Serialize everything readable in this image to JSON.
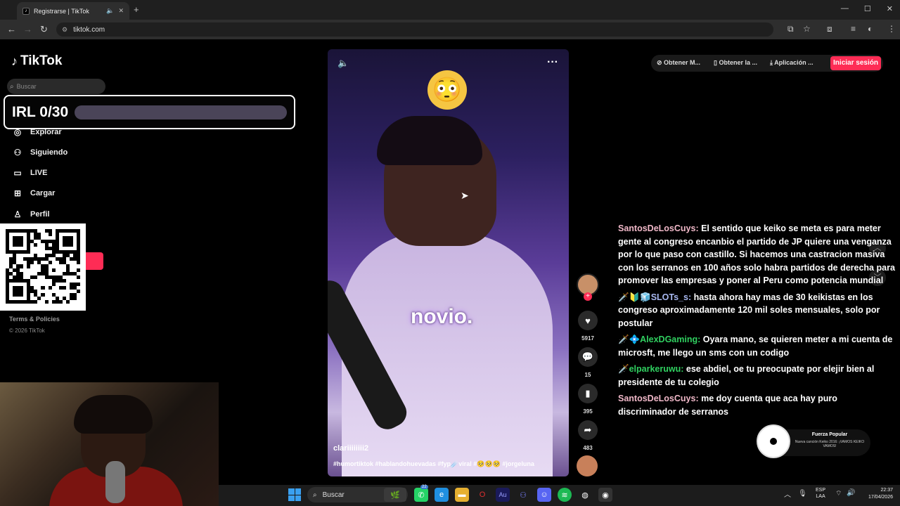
{
  "browser": {
    "tab_title": "Registrarse | TikTok",
    "tab_favicon": "tiktok-favicon",
    "url": "tiktok.com",
    "new_tab": "+",
    "win_controls": [
      "—",
      "☐",
      "✕"
    ]
  },
  "tiktok": {
    "logo": "TikTok",
    "search_placeholder": "Buscar",
    "nav": [
      {
        "label": "Explorar",
        "icon": "compass-icon"
      },
      {
        "label": "Siguiendo",
        "icon": "users-icon"
      },
      {
        "label": "LIVE",
        "icon": "live-icon"
      },
      {
        "label": "Cargar",
        "icon": "upload-icon"
      },
      {
        "label": "Perfil",
        "icon": "person-icon"
      }
    ],
    "terms": "Terms & Policies",
    "copyright": "© 2026 TikTok",
    "topbar": {
      "item1": "Obtener M...",
      "item2": "Obtener la ...",
      "item3": "Aplicación ...",
      "login": "Iniciar sesión"
    }
  },
  "irl_goal": {
    "label": "IRL 0/30",
    "progress": 0
  },
  "video": {
    "caption": "novio.",
    "username": "clariiiiiiii2",
    "hashtags": "#humortiktok #hablandohuevadas #fyp☄️viral #🥺🥺🥺 #jorgeluna",
    "emoji": "😳",
    "likes": "5917",
    "comments": "15",
    "saves": "395",
    "shares": "483"
  },
  "chat": [
    {
      "user": "SantosDeLosCuys:",
      "color": "#f0b8c8",
      "badges": "",
      "text": " El sentido que keiko se meta es para meter gente al congreso encanbio el partido de JP quiere una venganza por lo que paso con castillo. Si hacemos una castracion masiva con los serranos en 100 años solo habra partidos de derecha para promover las empresas y poner al Peru como potencia mundial"
    },
    {
      "user": "SLOTs_s:",
      "color": "#a8b8f0",
      "badges": "🗡️🔰🧊",
      "text": " hasta ahora hay mas de 30 keikistas en los congreso aproximadamente 120 mil soles mensuales, solo por postular"
    },
    {
      "user": "AlexDGaming:",
      "color": "#30d060",
      "badges": "🗡️💠",
      "text": " Oyara mano, se quieren meter a mi cuenta de microsft, me llego un sms con un codigo"
    },
    {
      "user": "elparkeruwu:",
      "color": "#30d060",
      "badges": "🗡️",
      "text": " ese abdiel, oe tu preocupate por elejir bien al presidente de tu colegio"
    },
    {
      "user": "SantosDeLosCuys:",
      "color": "#f0b8c8",
      "badges": "",
      "text": " me doy cuenta que aca hay puro discriminador de serranos"
    }
  ],
  "music_widget": {
    "title": "Fuerza Popular",
    "subtitle": "Nueva canción Keiko 2016: ¡VAMOS KEIKO VAMOS!"
  },
  "taskbar": {
    "search": "Buscar",
    "lang_top": "ESP",
    "lang_bottom": "LAA",
    "time": "22:37",
    "date": "17/04/2026",
    "badge": "22"
  },
  "colors": {
    "accent": "#fe2c55",
    "progress_fill": "#8b6cd8",
    "progress_track": "#4a4458"
  }
}
